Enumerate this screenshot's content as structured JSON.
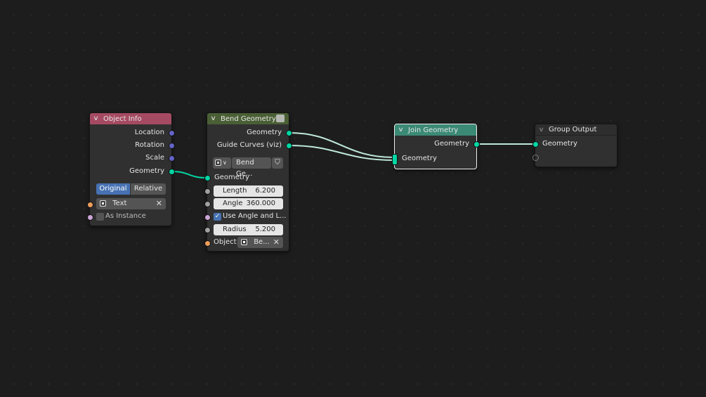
{
  "nodes": {
    "object_info": {
      "title": "Object Info",
      "outputs": [
        "Location",
        "Rotation",
        "Scale",
        "Geometry"
      ],
      "transform_space": {
        "options": [
          "Original",
          "Relative"
        ],
        "selected": "Original"
      },
      "object_field": "Text",
      "as_instance_label": "As Instance",
      "as_instance_checked": false
    },
    "bend_geometry": {
      "title": "Bend Geometry",
      "outputs": [
        "Geometry",
        "Guide Curves (viz)"
      ],
      "group_selector": "Bend Ge...",
      "inputs": {
        "geometry": "Geometry",
        "length_label": "Length",
        "length_value": "6.200",
        "angle_label": "Angle",
        "angle_value": "360.000",
        "use_angle_label": "Use Angle and L...",
        "use_angle_checked": true,
        "radius_label": "Radius",
        "radius_value": "5.200",
        "object_label": "Object:",
        "object_value": "Be..."
      }
    },
    "join_geometry": {
      "title": "Join Geometry",
      "output": "Geometry",
      "input": "Geometry"
    },
    "group_output": {
      "title": "Group Output",
      "input": "Geometry"
    }
  },
  "colors": {
    "background": "#1d1d1d",
    "node_body": "#303030",
    "header_object_info": "#a54a62",
    "header_bend_geometry": "#4a5f35",
    "header_join_geometry": "#3b8a75",
    "header_group_output": "#2e2e2e",
    "socket_geometry": "#00d6a3",
    "socket_vector": "#6363c7",
    "socket_float": "#a1a1a1",
    "socket_object": "#ed9e5c",
    "socket_boolean": "#cca6d6",
    "selection_blue": "#4772b3"
  },
  "links": [
    {
      "from": "object_info.Geometry",
      "to": "bend_geometry.Geometry"
    },
    {
      "from": "bend_geometry.Geometry",
      "to": "join_geometry.Geometry"
    },
    {
      "from": "bend_geometry.Guide Curves (viz)",
      "to": "join_geometry.Geometry"
    },
    {
      "from": "join_geometry.Geometry",
      "to": "group_output.Geometry"
    }
  ]
}
